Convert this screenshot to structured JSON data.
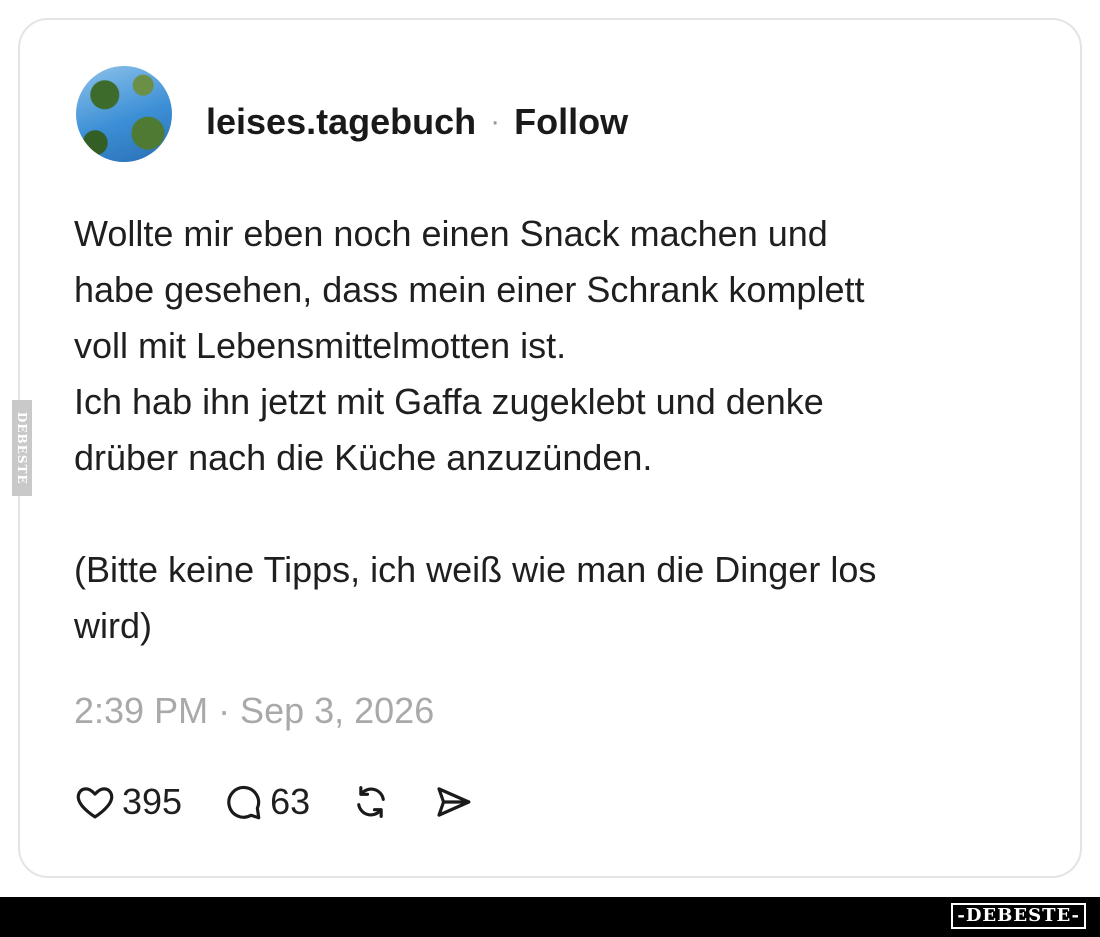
{
  "post": {
    "username": "leises.tagebuch",
    "separator": "·",
    "follow_label": "Follow",
    "body_lines": [
      "Wollte mir eben noch einen Snack machen und",
      "habe gesehen, dass mein einer Schrank komplett",
      "voll mit Lebensmittelmotten ist.",
      "Ich hab ihn jetzt mit Gaffa zugeklebt und denke",
      "drüber nach die Küche anzuzünden.",
      "",
      "(Bitte keine Tipps, ich weiß wie man die Dinger los",
      "wird)"
    ],
    "timestamp": "2:39 PM · Sep 3, 2026",
    "actions": {
      "likes": "395",
      "comments": "63"
    }
  },
  "watermark": {
    "side_text": "DEBESTE",
    "footer_logo": "-DEBESTE-"
  },
  "icons": {
    "like": "heart-icon",
    "comment": "speech-bubble-icon",
    "repost": "repost-icon",
    "share": "send-icon"
  },
  "colors": {
    "text": "#1a1a1a",
    "muted": "#a9a9a9",
    "border": "#e4e4e4",
    "footer": "#000000"
  }
}
